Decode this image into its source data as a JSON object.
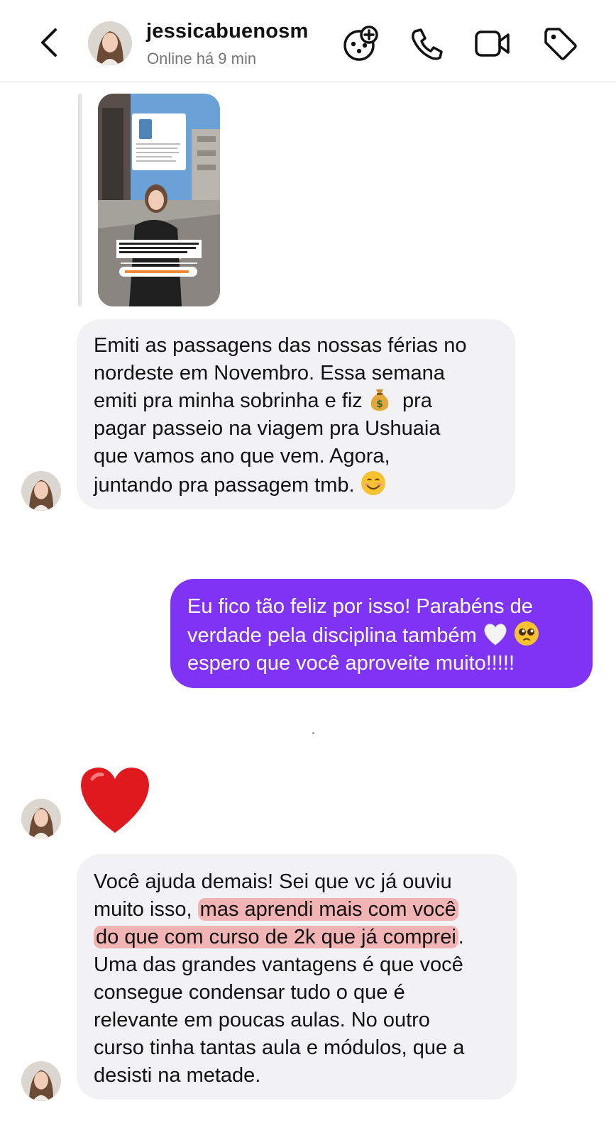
{
  "header": {
    "username": "jessicabuenosm",
    "status": "Online há 9 min",
    "icons": [
      "back-icon",
      "effects-icon",
      "phone-icon",
      "video-icon",
      "tag-icon"
    ]
  },
  "story_reply": {
    "thumbnail_caption": "A TVPM é a comunidade onde te ensino a emitir passagens aéreas e hospedagens baratas de VERDADE, tudo do zero! É entrar e viajar",
    "thumbnail_button": "Garantir minha vaga agora"
  },
  "messages": [
    {
      "sender": "them",
      "lines": [
        "Emiti as passagens das nossas férias no",
        "nordeste em Novembro. Essa semana",
        "emiti pra minha sobrinha e fiz",
        "pra",
        "pagar passeio na viagem pra Ushuaia",
        "que vamos ano que vem. Agora,",
        "juntando pra passagem tmb."
      ]
    },
    {
      "sender": "me",
      "lines": [
        "Eu fico tão feliz por isso! Parabéns de",
        "verdade pela disciplina também",
        "espero que você aproveite muito!!!!!"
      ]
    },
    {
      "sender": "them",
      "reaction": "red-heart"
    },
    {
      "sender": "them",
      "lines": [
        "Você ajuda demais! Sei que vc já ouviu",
        "muito isso,",
        "mas aprendi mais com você",
        "do que com curso de 2k que já comprei",
        ".",
        "Uma das grandes vantagens é que você",
        "consegue condensar tudo o que é",
        "relevante em poucas aulas. No outro",
        "curso tinha tantas aula e módulos, que a",
        "desisti na metade."
      ]
    }
  ],
  "colors": {
    "sent_bubble": "#7f33f5",
    "received_bubble": "#f2f2f4",
    "highlight": "#f28080",
    "status_text": "#767676"
  }
}
